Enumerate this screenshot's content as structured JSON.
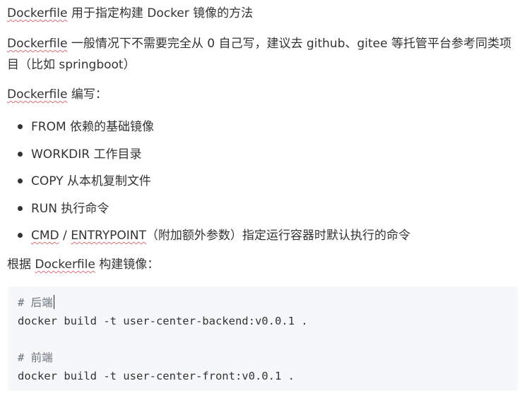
{
  "paragraphs": {
    "p1": {
      "word": "Dockerfile",
      "rest": " 用于指定构建 Docker 镜像的方法"
    },
    "p2": {
      "word": "Dockerfile",
      "rest": " 一般情况下不需要完全从 0 自己写，建议去 github、gitee 等托管平台参考同类项目（比如 springboot）"
    },
    "p3": {
      "word": "Dockerfile",
      "rest": " 编写："
    },
    "p4": {
      "before": "根据 ",
      "word": "Dockerfile",
      "rest": " 构建镜像："
    }
  },
  "list": {
    "items": [
      {
        "text": "FROM 依赖的基础镜像"
      },
      {
        "text": "WORKDIR 工作目录"
      },
      {
        "text": "COPY 从本机复制文件"
      },
      {
        "text": "RUN 执行命令"
      },
      {
        "cmd": "CMD",
        "sep": " / ",
        "entry": "ENTRYPOINT",
        "rest": "（附加额外参数）指定运行容器时默认执行的命令"
      }
    ]
  },
  "code": {
    "lines": [
      "# 后端",
      "docker build -t user-center-backend:v0.0.1 .",
      "# 前端",
      "docker build -t user-center-front:v0.0.1 ."
    ]
  }
}
